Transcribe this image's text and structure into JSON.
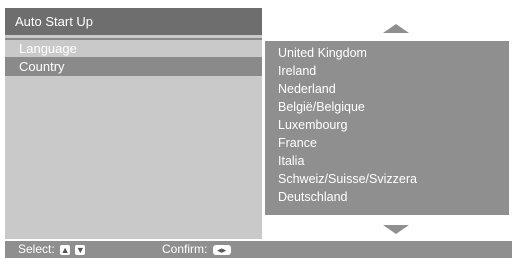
{
  "title": "Auto Start Up",
  "menu": {
    "items": [
      {
        "label": "Language"
      },
      {
        "label": "Country"
      }
    ],
    "selected": "Country"
  },
  "countries": [
    "United Kingdom",
    "Ireland",
    "Nederland",
    "België/Belgique",
    "Luxembourg",
    "France",
    "Italia",
    "Schweiz/Suisse/Svizzera",
    "Deutschland"
  ],
  "footer": {
    "select_label": "Select:",
    "confirm_label": "Confirm:"
  },
  "icons": {
    "scroll_up": "triangle-up",
    "scroll_down": "triangle-down",
    "select_up": "arrow-up-key",
    "select_down": "arrow-down-key",
    "confirm": "enter-key"
  },
  "colors": {
    "title_bar": "#6e6e6e",
    "left_panel": "#c9c9c9",
    "right_panel": "#8f8f8f",
    "selected_item": "#8a8a8a",
    "text": "#ffffff"
  }
}
